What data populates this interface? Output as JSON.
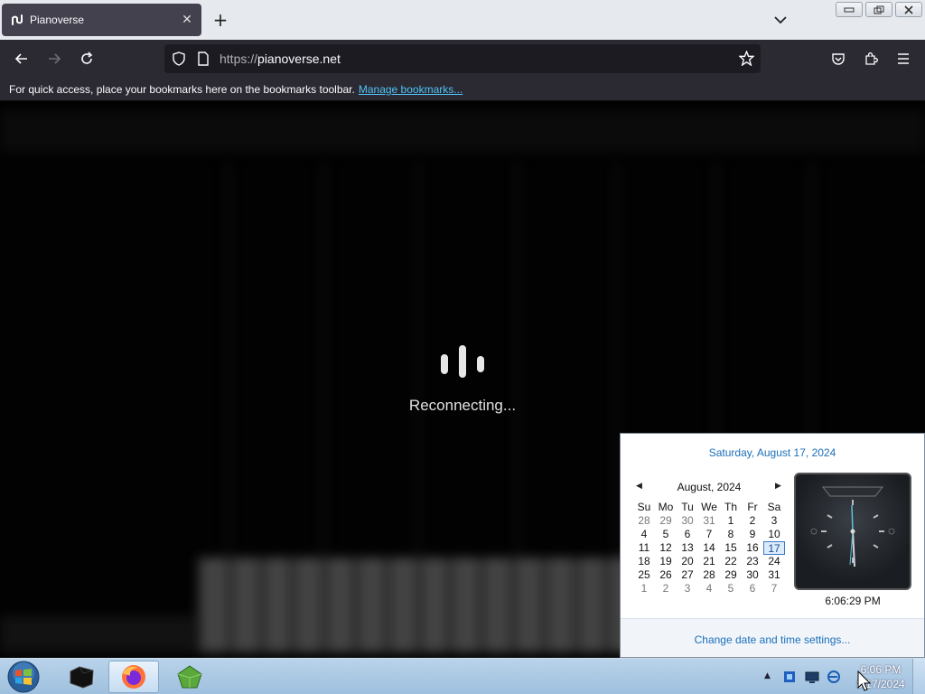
{
  "browser": {
    "tab": {
      "title": "Pianoverse",
      "close_label": "✕"
    },
    "new_tab_label": "+",
    "url": {
      "protocol": "https://",
      "host": "pianoverse.net"
    },
    "bookmarks_bar": {
      "message": "For quick access, place your bookmarks here on the bookmarks toolbar.",
      "link": "Manage bookmarks..."
    }
  },
  "page": {
    "status_text": "Reconnecting..."
  },
  "calendar_popup": {
    "date_heading": "Saturday, August 17, 2024",
    "month_label": "August, 2024",
    "weekdays": [
      "Su",
      "Mo",
      "Tu",
      "We",
      "Th",
      "Fr",
      "Sa"
    ],
    "weeks": [
      [
        "28",
        "29",
        "30",
        "31",
        "1",
        "2",
        "3"
      ],
      [
        "4",
        "5",
        "6",
        "7",
        "8",
        "9",
        "10"
      ],
      [
        "11",
        "12",
        "13",
        "14",
        "15",
        "16",
        "17"
      ],
      [
        "18",
        "19",
        "20",
        "21",
        "22",
        "23",
        "24"
      ],
      [
        "25",
        "26",
        "27",
        "28",
        "29",
        "30",
        "31"
      ],
      [
        "1",
        "2",
        "3",
        "4",
        "5",
        "6",
        "7"
      ]
    ],
    "selected_day": "17",
    "clock_time": "6:06:29 PM",
    "settings_link": "Change date and time settings..."
  },
  "taskbar": {
    "items": [
      {
        "icon": "black-box-app-icon"
      },
      {
        "icon": "firefox-icon",
        "active": true
      },
      {
        "icon": "green-gem-app-icon"
      }
    ],
    "clock": {
      "time": "6:06 PM",
      "date": "8/17/2024"
    }
  },
  "colors": {
    "tab_bg": "#42414d",
    "toolbar_bg": "#2b2a33",
    "link_blue": "#1a6fb8",
    "bookmark_link": "#4fc3f7"
  }
}
